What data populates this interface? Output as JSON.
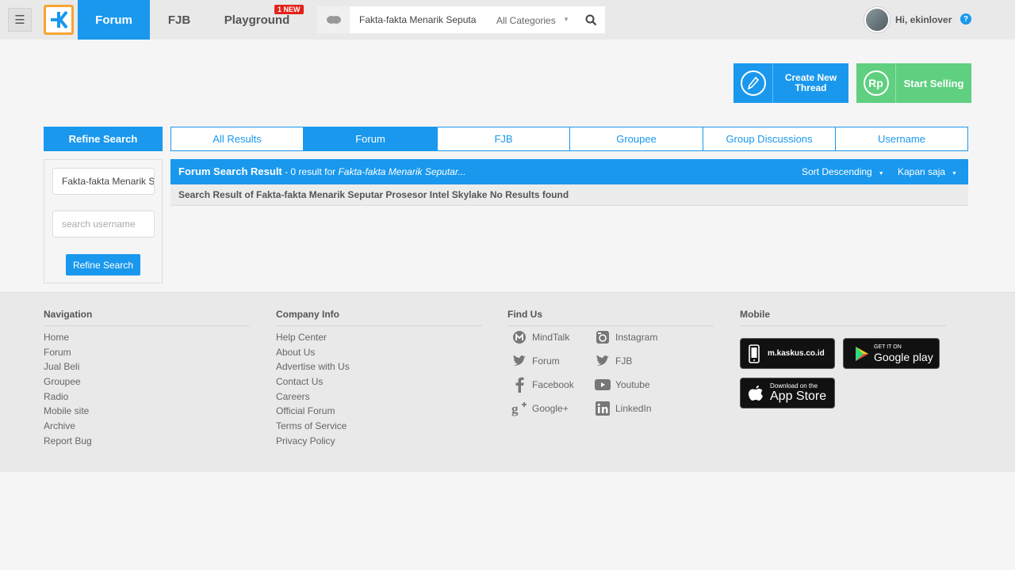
{
  "header": {
    "nav": {
      "forum": "Forum",
      "fjb": "FJB",
      "playground": "Playground",
      "new_badge": "1 NEW"
    },
    "search": {
      "query": "Fakta-fakta Menarik Seputa",
      "category": "All Categories"
    },
    "user": {
      "greeting": "Hi, ekinlover",
      "help": "?"
    }
  },
  "actions": {
    "create_thread": "Create New Thread",
    "start_selling": "Start Selling",
    "rp_symbol": "Rp"
  },
  "refine": {
    "header": "Refine Search",
    "keyword": "Fakta-fakta Menarik Seputar Prosesor Intel Skylake",
    "username_placeholder": "search username",
    "button": "Refine Search"
  },
  "tabs": [
    "All Results",
    "Forum",
    "FJB",
    "Groupee",
    "Group Discussions",
    "Username"
  ],
  "result": {
    "title": "Forum Search Result",
    "summary": " - 0 result for ",
    "query_preview": "Fakta-fakta Menarik Seputar...",
    "sort": "Sort Descending",
    "time": "Kapan saja",
    "message": "Search Result of Fakta-fakta Menarik Seputar Prosesor Intel Skylake No Results found"
  },
  "footer": {
    "navigation": {
      "title": "Navigation",
      "links": [
        "Home",
        "Forum",
        "Jual Beli",
        "Groupee",
        "Radio",
        "Mobile site",
        "Archive",
        "Report Bug"
      ]
    },
    "company": {
      "title": "Company Info",
      "links": [
        "Help Center",
        "About Us",
        "Advertise with Us",
        "Contact Us",
        "Careers",
        "Official Forum",
        "Terms of Service",
        "Privacy Policy"
      ]
    },
    "find_us": {
      "title": "Find Us",
      "items": [
        "MindTalk",
        "Instagram",
        "Forum",
        "FJB",
        "Facebook",
        "Youtube",
        "Google+",
        "LinkedIn"
      ]
    },
    "mobile": {
      "title": "Mobile",
      "mobile_site": "m.kaskus.co.id",
      "google_play_small": "GET IT ON",
      "google_play": "Google play",
      "app_store_small": "Download on the",
      "app_store": "App Store"
    }
  },
  "colors": {
    "primary": "#1998ed",
    "green": "#5fcf80",
    "logo_orange": "#f7a531",
    "badge_red": "#e2231a"
  }
}
